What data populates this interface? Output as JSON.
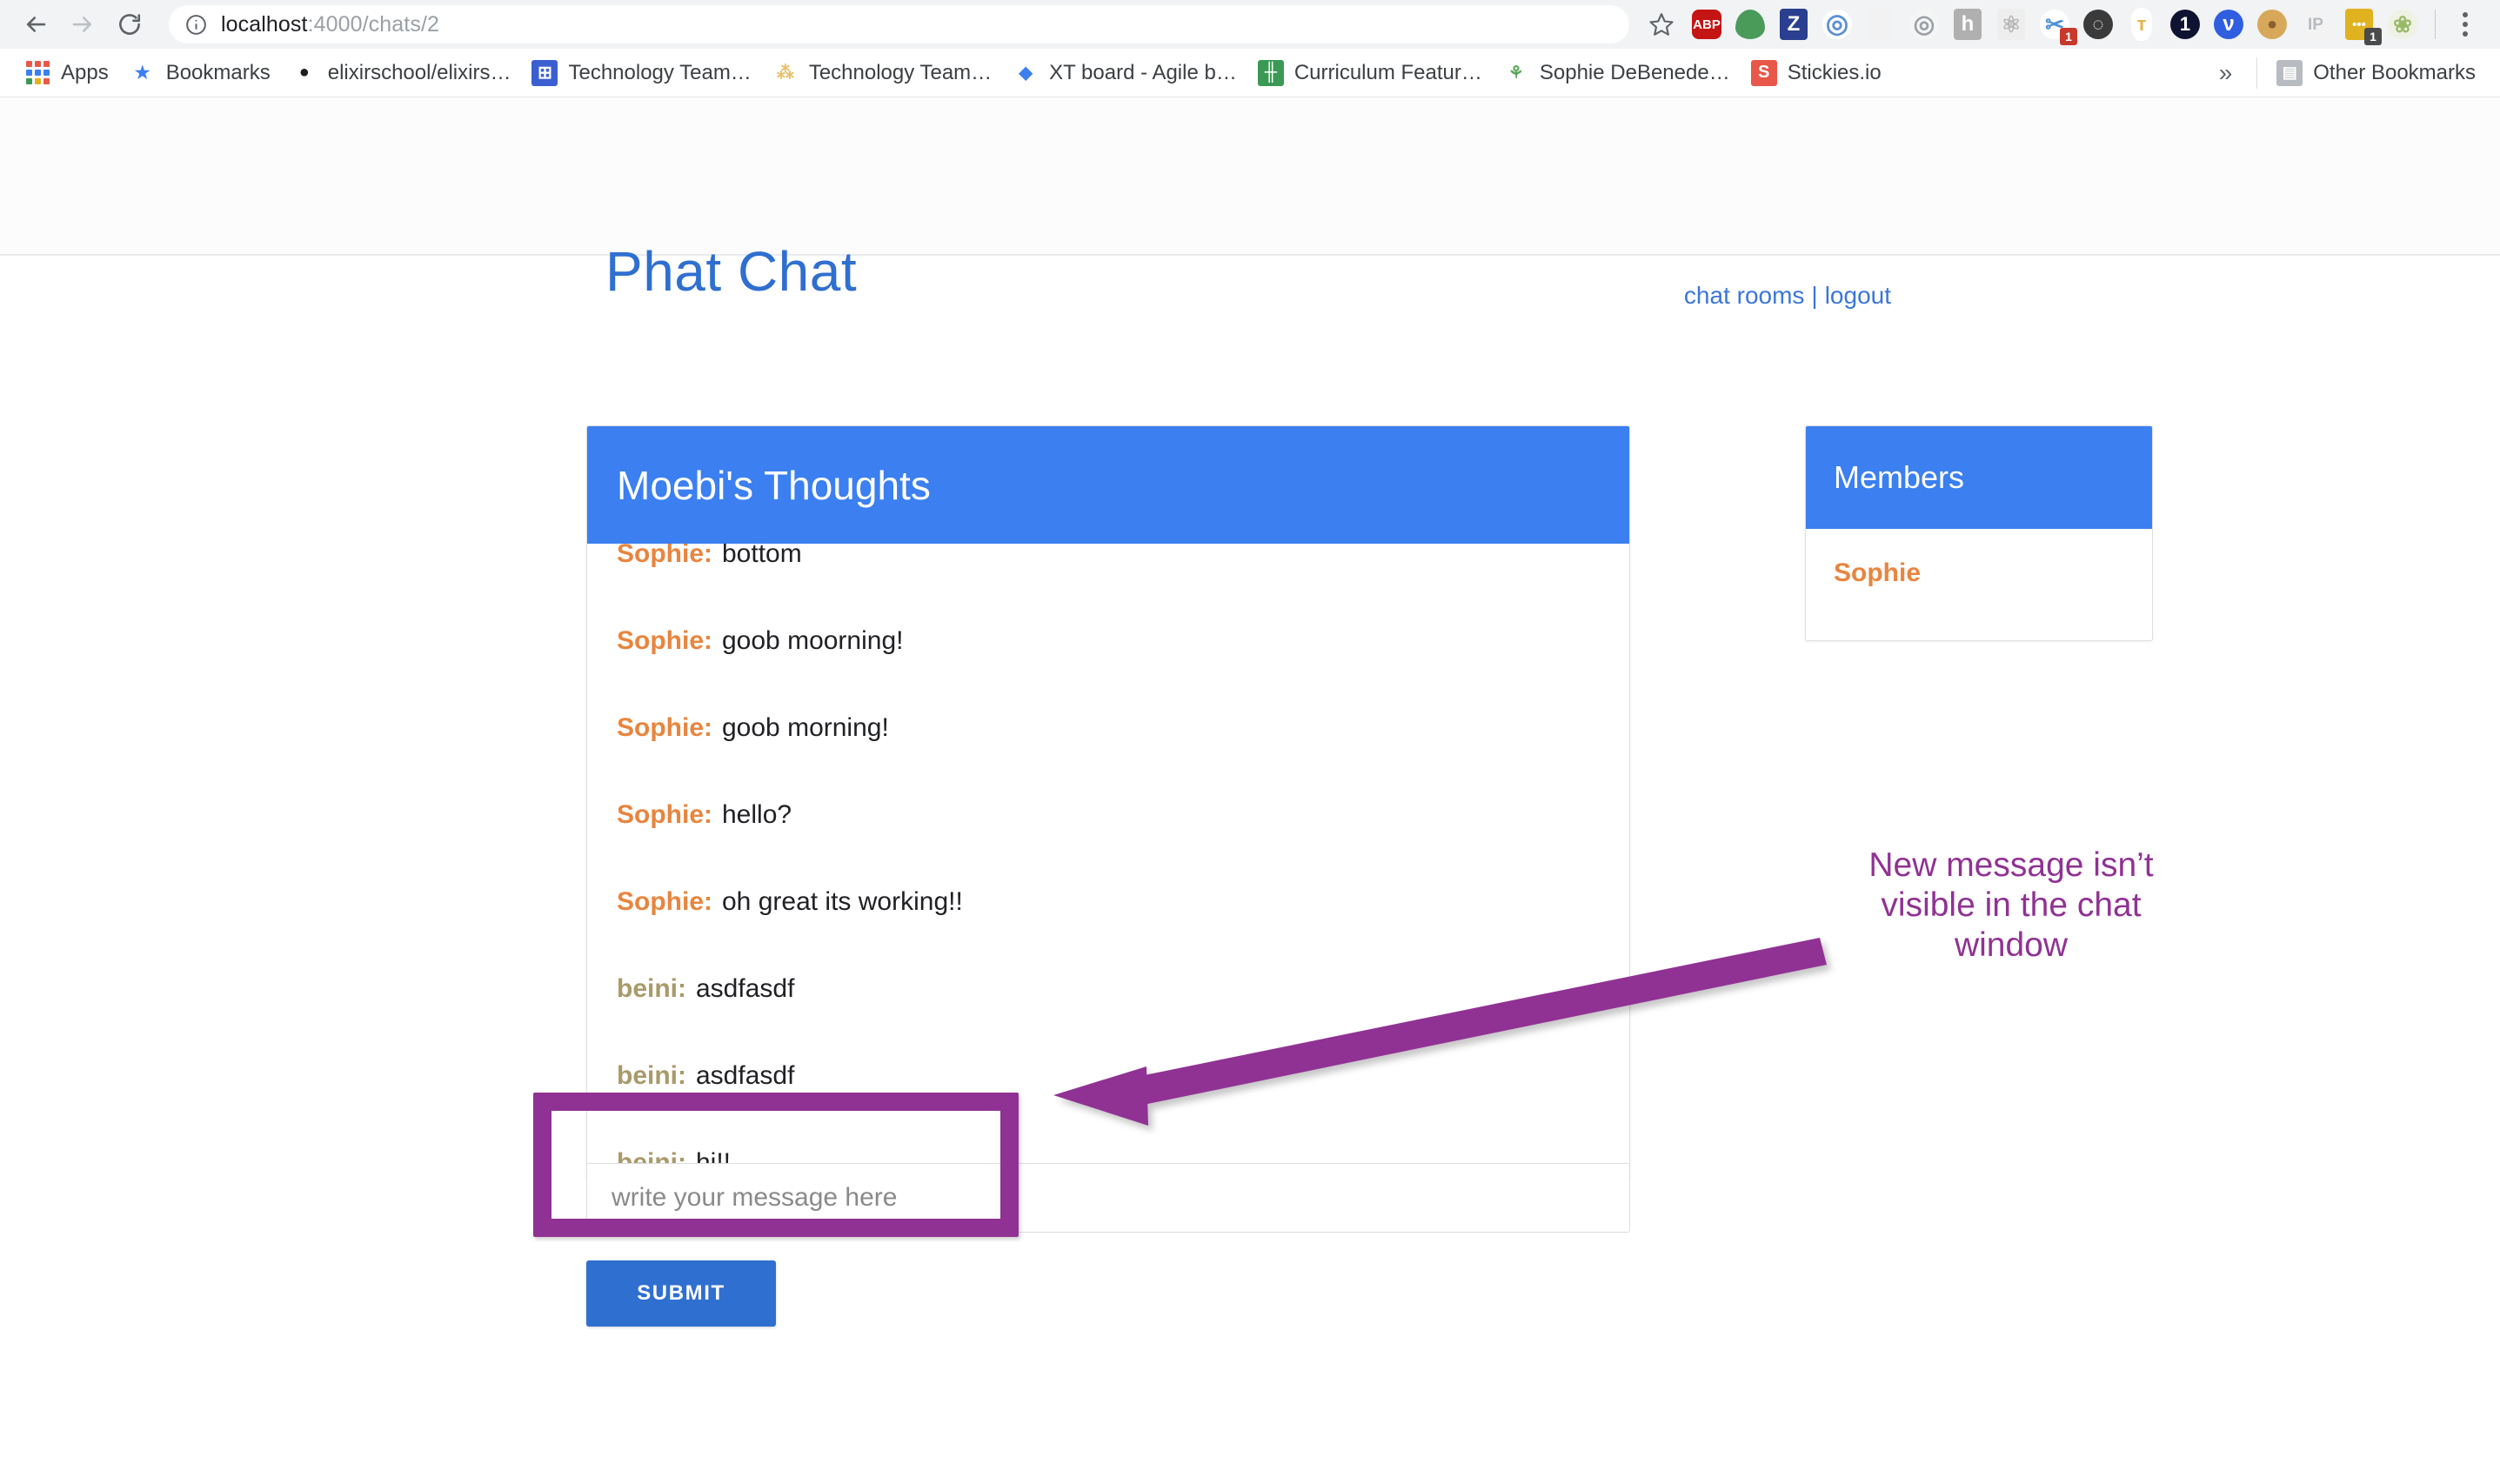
{
  "browser": {
    "nav": {
      "back_icon": "back-arrow-icon",
      "forward_icon": "forward-arrow-icon",
      "reload_icon": "reload-icon"
    },
    "omnibox": {
      "info_icon": "info-circle-icon",
      "url_host": "localhost",
      "url_path": ":4000/chats/2",
      "full_url": "localhost:4000/chats/2",
      "star_icon": "bookmark-star-icon"
    },
    "extensions": [
      {
        "name": "adblock-plus-extension",
        "glyph": "ABP",
        "bg": "#c41414",
        "fg": "#ffffff",
        "shape": "octagon",
        "font_size": "15px"
      },
      {
        "name": "green-leaf-extension",
        "glyph": "",
        "bg": "#4a9a5a",
        "fg": "#ffffff",
        "shape": "leaf",
        "font_size": "16px"
      },
      {
        "name": "zotero-extension",
        "glyph": "Z",
        "bg": "#2a3f8f",
        "fg": "#ffffff",
        "shape": "square",
        "font_size": "24px"
      },
      {
        "name": "loop-extension",
        "glyph": "◎",
        "bg": "#ffffff",
        "fg": "#5b8fd6",
        "shape": "ring",
        "font_size": "30px"
      },
      {
        "name": "note-page-extension",
        "glyph": "",
        "bg": "#f2f2f2",
        "fg": "#d84040",
        "shape": "page",
        "font_size": "16px"
      },
      {
        "name": "target-circle-extension",
        "glyph": "◎",
        "bg": "#f5f5f5",
        "fg": "#9aa0a6",
        "shape": "ring",
        "font_size": "28px"
      },
      {
        "name": "honey-extension",
        "glyph": "h",
        "bg": "#b0b0b0",
        "fg": "#ffffff",
        "shape": "rounded",
        "font_size": "24px"
      },
      {
        "name": "react-devtools-extension",
        "glyph": "⚛",
        "bg": "#eeeeee",
        "fg": "#b6b6b6",
        "shape": "square",
        "font_size": "26px"
      },
      {
        "name": "scissors-extension",
        "glyph": "✂",
        "bg": "#ffffff",
        "fg": "#4a8fdc",
        "shape": "plain",
        "font_size": "26px",
        "badge": "1",
        "badge_bg": "#c8392b"
      },
      {
        "name": "film-reel-extension",
        "glyph": "◌",
        "bg": "#3a3a3a",
        "fg": "#ffffff",
        "shape": "circle",
        "font_size": "22px"
      },
      {
        "name": "test-tube-extension",
        "glyph": "ᴛ",
        "bg": "#ffffff",
        "fg": "#e8b44a",
        "shape": "tube",
        "font_size": "22px"
      },
      {
        "name": "onetab-extension",
        "glyph": "1",
        "bg": "#0d1330",
        "fg": "#ffffff",
        "shape": "circle",
        "font_size": "22px"
      },
      {
        "name": "vimium-extension",
        "glyph": "ν",
        "bg": "#2f5fe0",
        "fg": "#ffffff",
        "shape": "circle",
        "font_size": "24px"
      },
      {
        "name": "cookie-extension",
        "glyph": "●",
        "bg": "#d8a85a",
        "fg": "#8a6030",
        "shape": "circle",
        "font_size": "20px"
      },
      {
        "name": "ip-address-extension",
        "glyph": "IP",
        "bg": "#f3f3f3",
        "fg": "#b8bcc0",
        "shape": "square",
        "font_size": "19px"
      },
      {
        "name": "evernote-extension",
        "glyph": "•••",
        "bg": "#e0b21f",
        "fg": "#ffffff",
        "shape": "square",
        "font_size": "15px",
        "badge": "1",
        "badge_bg": "#4a4a4a"
      },
      {
        "name": "flower-profile-extension",
        "glyph": "❀",
        "bg": "#eef2e4",
        "fg": "#9aba6a",
        "shape": "circle",
        "font_size": "26px"
      }
    ],
    "menu_icon": "three-dot-menu-icon",
    "bookmarks": [
      {
        "name": "apps",
        "label": "Apps",
        "icon": "apps-grid-icon"
      },
      {
        "name": "bookmarks-folder",
        "label": "Bookmarks",
        "icon": "star-icon",
        "icon_bg": "transparent",
        "icon_fg": "#3b7ff0",
        "glyph": "★"
      },
      {
        "name": "elixirschool",
        "label": "elixirschool/elixirs…",
        "icon": "github-icon",
        "icon_bg": "transparent",
        "icon_fg": "#1b1f23",
        "glyph": "●"
      },
      {
        "name": "technology-team-sheet",
        "label": "Technology Team…",
        "icon": "google-sheets-icon",
        "icon_bg": "#3b5fd0",
        "icon_fg": "#ffffff",
        "glyph": "⊞"
      },
      {
        "name": "technology-team-doc",
        "label": "Technology Team…",
        "icon": "confluence-icon",
        "icon_bg": "transparent",
        "icon_fg": "#e8c06a",
        "glyph": "⁂"
      },
      {
        "name": "xt-board",
        "label": "XT board - Agile b…",
        "icon": "jira-diamond-icon",
        "icon_bg": "transparent",
        "icon_fg": "#3b7ff0",
        "glyph": "◆"
      },
      {
        "name": "curriculum-features",
        "label": "Curriculum Featur…",
        "icon": "trello-icon",
        "icon_bg": "#3a9a55",
        "icon_fg": "#ffffff",
        "glyph": "╫"
      },
      {
        "name": "sophie-debenedetto",
        "label": "Sophie DeBenede…",
        "icon": "medium-icon",
        "icon_bg": "transparent",
        "icon_fg": "#5aa85a",
        "glyph": "⚘"
      },
      {
        "name": "stickies-io",
        "label": "Stickies.io",
        "icon": "stickies-icon",
        "icon_bg": "#e8574a",
        "icon_fg": "#ffffff",
        "glyph": "S"
      }
    ],
    "overflow_label": "»",
    "other_bookmarks": {
      "label": "Other Bookmarks",
      "icon": "folder-icon",
      "glyph": "▤"
    }
  },
  "site": {
    "brand": "Phat Chat",
    "nav": {
      "chat_rooms": "chat rooms",
      "separator": "|",
      "logout": "logout"
    }
  },
  "chat": {
    "title": "Moebi's Thoughts",
    "messages": [
      {
        "author": "Sophie",
        "author_class": "sophie",
        "text": "bottom"
      },
      {
        "author": "Sophie",
        "author_class": "sophie",
        "text": "goob moorning!"
      },
      {
        "author": "Sophie",
        "author_class": "sophie",
        "text": "goob morning!"
      },
      {
        "author": "Sophie",
        "author_class": "sophie",
        "text": "hello?"
      },
      {
        "author": "Sophie",
        "author_class": "sophie",
        "text": "oh great its working!!"
      },
      {
        "author": "beini",
        "author_class": "beini",
        "text": "asdfasdf"
      },
      {
        "author": "beini",
        "author_class": "beini",
        "text": "asdfasdf"
      },
      {
        "author": "beini",
        "author_class": "beini",
        "text": "hi!!"
      }
    ],
    "input": {
      "placeholder": "write your message here",
      "value": ""
    },
    "submit_label": "SUBMIT"
  },
  "members": {
    "title": "Members",
    "list": [
      {
        "name": "Sophie"
      }
    ]
  },
  "annotation": {
    "text": "New message isn’t visible in the chat window",
    "color": "#903293"
  },
  "colors": {
    "accent_blue": "#3b7ff0",
    "button_blue": "#2f6fd0",
    "link_blue": "#3b76d8",
    "sophie_orange": "#e8853f",
    "beini_tan": "#a89a6a",
    "annotation_purple": "#903293"
  }
}
